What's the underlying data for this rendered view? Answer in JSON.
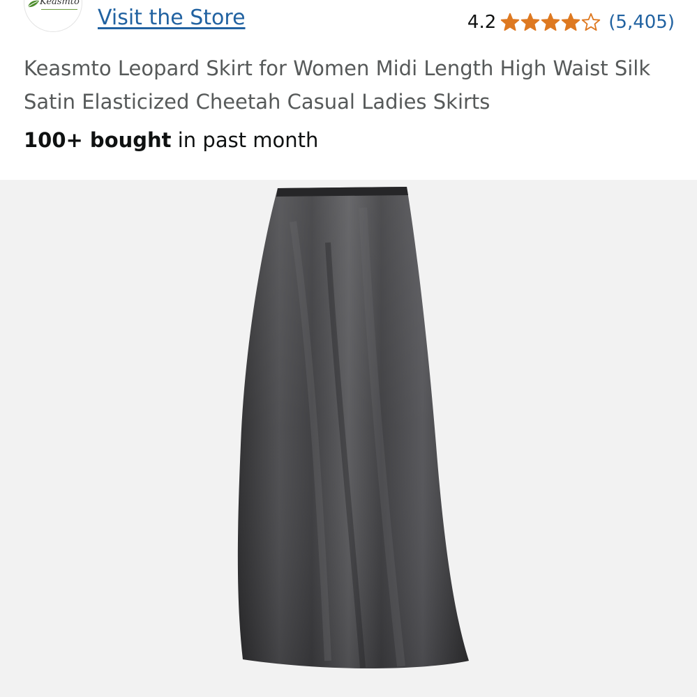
{
  "store": {
    "logo_text": "Keasmto",
    "link_label": "Visit the Store"
  },
  "rating": {
    "value": "4.2",
    "stars_out_of_5": 4.2,
    "review_count": "(5,405)",
    "star_color": "#de7921"
  },
  "product": {
    "title": "Keasmto Leopard Skirt for Women Midi Length High Waist Silk Satin Elasticized Cheetah Casual Ladies Skirts",
    "bought_bold": "100+ bought",
    "bought_rest": " in past month"
  },
  "colors": {
    "link": "#2162a1",
    "title": "#565959",
    "image_background": "#f2f2f2"
  }
}
